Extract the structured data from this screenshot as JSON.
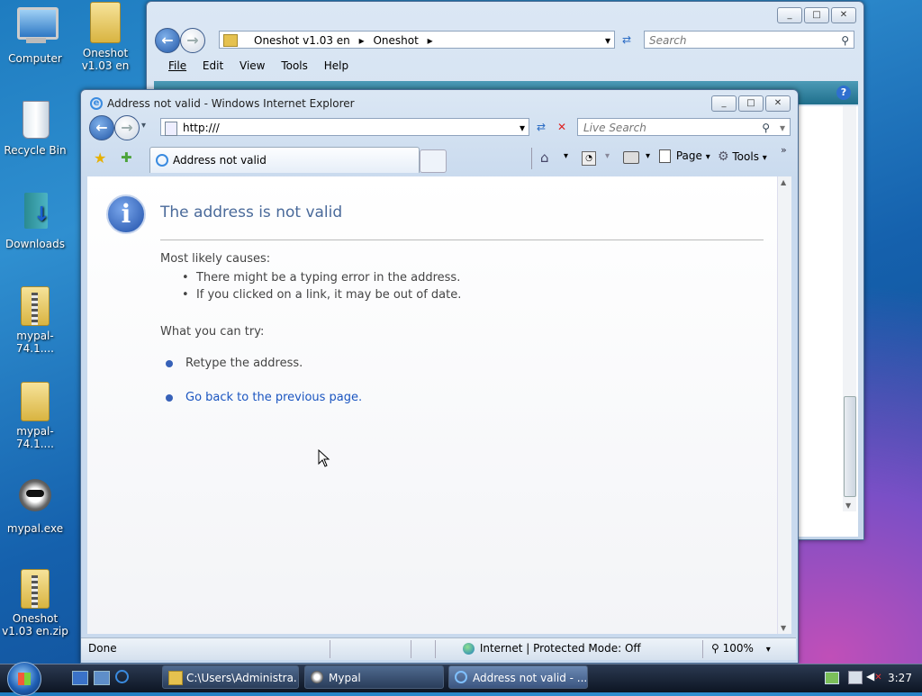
{
  "desktop": {
    "icons": [
      {
        "label": "Computer",
        "icon": "computer-icon"
      },
      {
        "label": "Recycle Bin",
        "icon": "recycle-bin-icon"
      },
      {
        "label": "Downloads",
        "icon": "downloads-icon"
      },
      {
        "label": "mypal-74.1....",
        "icon": "zip-folder-icon"
      },
      {
        "label": "mypal-74.1....",
        "icon": "folder-icon"
      },
      {
        "label": "mypal.exe",
        "icon": "raccoon-icon"
      },
      {
        "label": "Oneshot v1.03 en.zip",
        "icon": "zip-folder-icon"
      },
      {
        "label": "Oneshot v1.03 en",
        "icon": "folder-icon"
      }
    ]
  },
  "explorer": {
    "breadcrumb": [
      "Oneshot v1.03 en",
      "Oneshot"
    ],
    "search_placeholder": "Search",
    "menu": [
      "File",
      "Edit",
      "View",
      "Tools",
      "Help"
    ]
  },
  "ie": {
    "title": "Address not valid - Windows Internet Explorer",
    "address": "http:///",
    "search_placeholder": "Live Search",
    "tab_label": "Address not valid",
    "toolbar": {
      "page": "Page",
      "tools": "Tools"
    },
    "content": {
      "heading": "The address is not valid",
      "causes_title": "Most likely causes:",
      "causes": [
        "There might be a typing error in the address.",
        "If you clicked on a link, it may be out of date."
      ],
      "try_title": "What you can try:",
      "retype": "Retype the address.",
      "go_back": "Go back to the previous page."
    },
    "status": {
      "left": "Done",
      "zone": "Internet | Protected Mode: Off",
      "zoom": "100%"
    }
  },
  "taskbar": {
    "buttons": [
      "C:\\Users\\Administra...",
      "Mypal",
      "Address not valid - ..."
    ],
    "clock": "3:27"
  },
  "colors": {
    "link": "#1a55c0",
    "heading": "#4a6a9a",
    "bullet": "#3761b8"
  }
}
